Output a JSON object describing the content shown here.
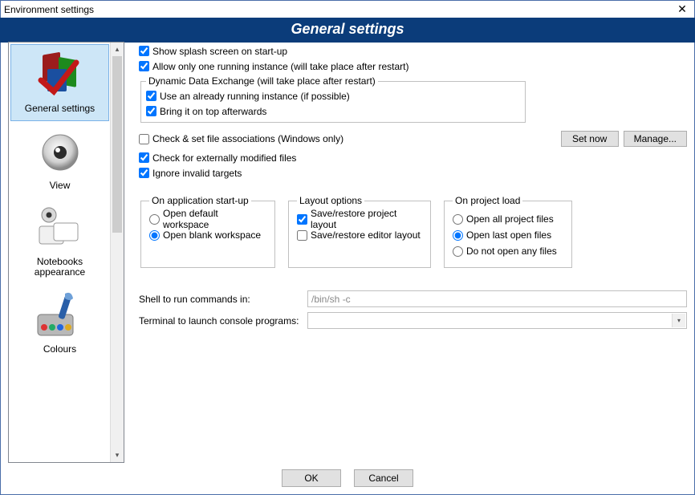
{
  "window": {
    "title": "Environment settings",
    "close_glyph": "✕"
  },
  "header": {
    "title": "General settings"
  },
  "sidebar": {
    "items": [
      {
        "label": "General settings",
        "selected": true
      },
      {
        "label": "View"
      },
      {
        "label": "Notebooks appearance"
      },
      {
        "label": "Colours"
      }
    ],
    "scroll_up_glyph": "▴",
    "scroll_down_glyph": "▾"
  },
  "settings": {
    "show_splash": {
      "label": "Show splash screen on start-up",
      "checked": true
    },
    "single_instance": {
      "label": "Allow only one running instance (will take place after restart)",
      "checked": true
    },
    "dde": {
      "legend": "Dynamic Data Exchange (will take place after restart)",
      "use_running": {
        "label": "Use an already running instance (if possible)",
        "checked": true
      },
      "bring_on_top": {
        "label": "Bring it on top afterwards",
        "checked": true
      }
    },
    "check_assoc": {
      "label": "Check & set file associations (Windows only)",
      "checked": false
    },
    "check_modified": {
      "label": "Check for externally modified files",
      "checked": true
    },
    "ignore_invalid": {
      "label": "Ignore invalid targets",
      "checked": true
    },
    "set_now_button": "Set now",
    "manage_button": "Manage...",
    "startup_group": {
      "legend": "On application start-up",
      "default_ws": {
        "label": "Open default workspace",
        "selected": false
      },
      "blank_ws": {
        "label": "Open blank workspace",
        "selected": true
      }
    },
    "layout_group": {
      "legend": "Layout options",
      "save_project": {
        "label": "Save/restore project layout",
        "checked": true
      },
      "save_editor": {
        "label": "Save/restore editor layout",
        "checked": false
      }
    },
    "project_load_group": {
      "legend": "On project load",
      "open_all": {
        "label": "Open all project files",
        "selected": false
      },
      "open_last": {
        "label": "Open last open files",
        "selected": true
      },
      "open_none": {
        "label": "Do not open any files",
        "selected": false
      }
    },
    "shell_label": "Shell to run commands in:",
    "shell_value": "/bin/sh -c",
    "terminal_label": "Terminal to launch console programs:",
    "terminal_value": ""
  },
  "buttons": {
    "ok": "OK",
    "cancel": "Cancel"
  },
  "combo_glyph": "▾"
}
